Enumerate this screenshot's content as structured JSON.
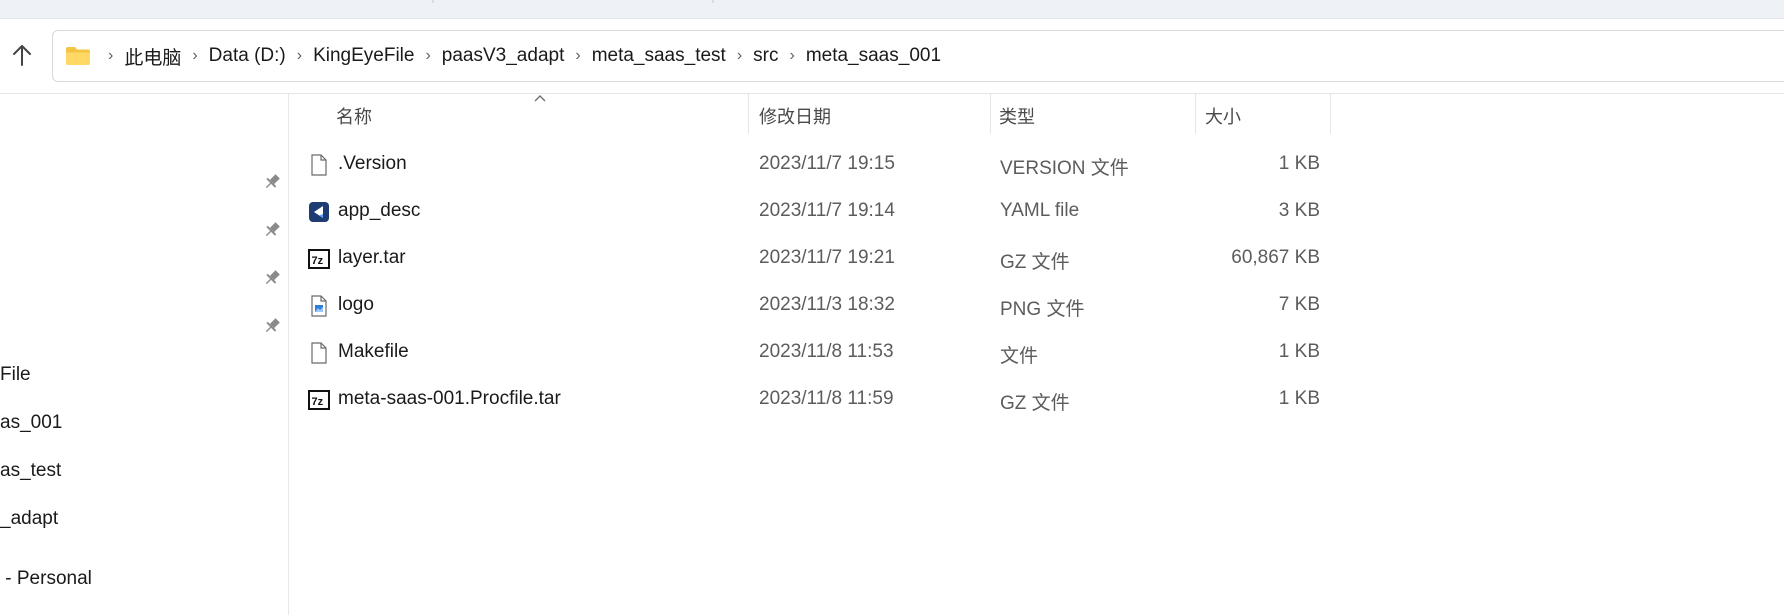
{
  "address_bar": {
    "crumbs": [
      "此电脑",
      "Data (D:)",
      "KingEyeFile",
      "paasV3_adapt",
      "meta_saas_test",
      "src",
      "meta_saas_001"
    ],
    "separator": "›"
  },
  "nav_pane": {
    "quick_access_items": [
      "File",
      "as_001",
      "as_test",
      "_adapt"
    ],
    "cloud_item": " - Personal"
  },
  "columns": {
    "name": "名称",
    "date": "修改日期",
    "type": "类型",
    "size": "大小"
  },
  "files": [
    {
      "name": ".Version",
      "date": "2023/11/7 19:15",
      "type": "VERSION 文件",
      "size": "1 KB",
      "icon": "generic-file-icon"
    },
    {
      "name": "app_desc",
      "date": "2023/11/7 19:14",
      "type": "YAML file",
      "size": "3 KB",
      "icon": "yaml-app-icon"
    },
    {
      "name": "layer.tar",
      "date": "2023/11/7 19:21",
      "type": "GZ 文件",
      "size": "60,867 KB",
      "icon": "7zip-archive-icon"
    },
    {
      "name": "logo",
      "date": "2023/11/3 18:32",
      "type": "PNG 文件",
      "size": "7 KB",
      "icon": "png-image-icon"
    },
    {
      "name": "Makefile",
      "date": "2023/11/8 11:53",
      "type": "文件",
      "size": "1 KB",
      "icon": "generic-file-icon"
    },
    {
      "name": "meta-saas-001.Procfile.tar",
      "date": "2023/11/8 11:59",
      "type": "GZ 文件",
      "size": "1 KB",
      "icon": "7zip-archive-icon"
    }
  ],
  "colors": {
    "folder": "#f4c542",
    "accent": "#0067c0"
  }
}
